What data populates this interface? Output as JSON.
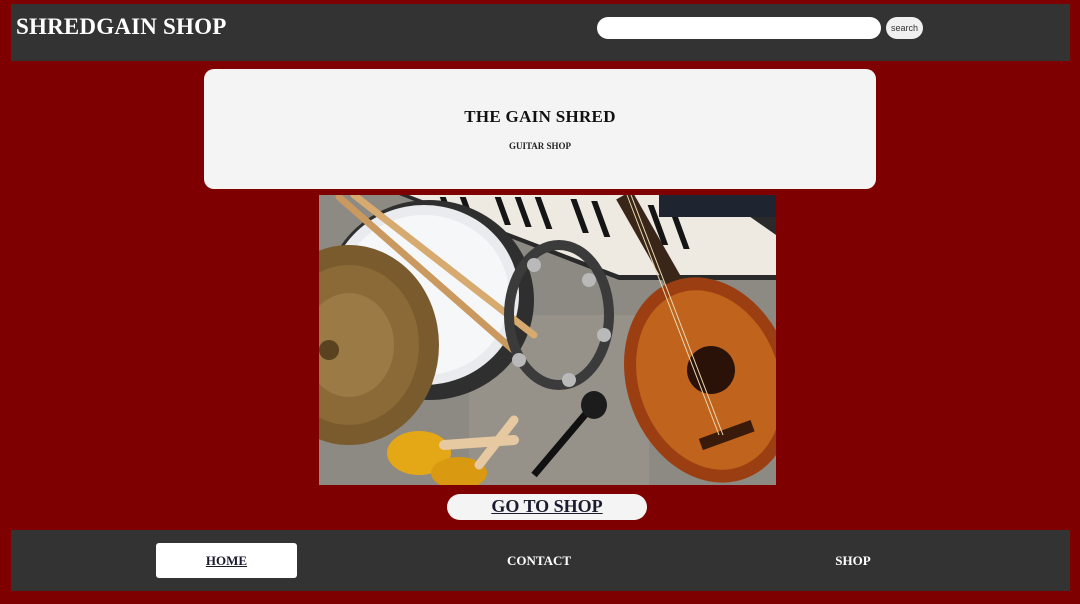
{
  "header": {
    "brand": "SHREDGAIN SHOP",
    "search_placeholder": "",
    "search_button": "search"
  },
  "hero": {
    "title": "THE GAIN SHRED",
    "subtitle": "GUITAR SHOP"
  },
  "photo": {
    "icons": [
      "cymbal-icon",
      "drum-icon",
      "drumsticks-icon",
      "keyboard-icon",
      "tambourine-icon",
      "maracas-icon",
      "microphone-icon",
      "acoustic-guitar-icon"
    ]
  },
  "cta": {
    "label": "GO TO SHOP"
  },
  "footer": {
    "nav": [
      {
        "label": "HOME"
      },
      {
        "label": "CONTACT"
      },
      {
        "label": "SHOP"
      }
    ]
  },
  "colors": {
    "page_background": "#7f0000",
    "bar_background": "#333333",
    "card_background": "#f4f4f4"
  }
}
